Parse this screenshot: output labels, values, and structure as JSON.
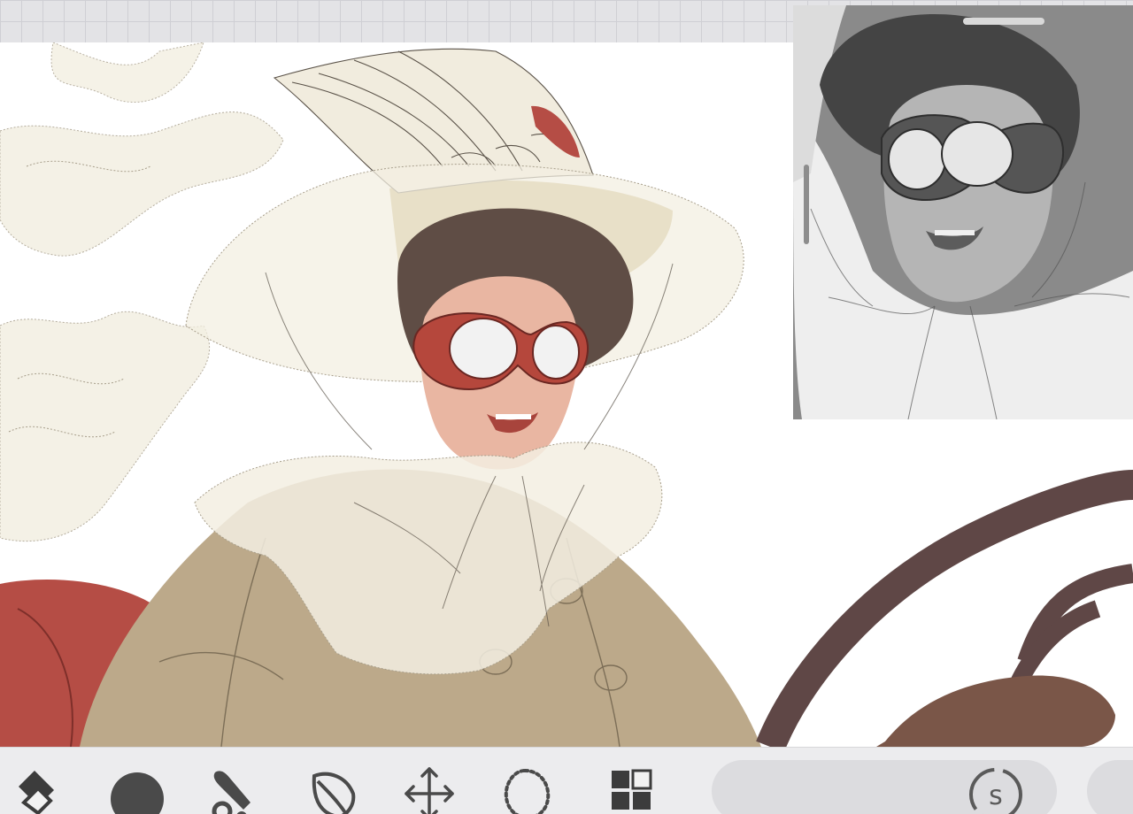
{
  "app": {
    "accent": "#4a4a4a",
    "canvas_background": "#ffffff"
  },
  "canvas": {
    "subject": "vintage-motorist-illustration",
    "palette": {
      "veil": "#f3efe2",
      "coat": "#bca98a",
      "hat_brim": "#c8b27c",
      "hair": "#5f4d45",
      "skin": "#e9b6a2",
      "goggles": "#b5473c",
      "seat": "#b54d45",
      "wheel": "#5f4746",
      "glove": "#7a5648"
    }
  },
  "reference_panel": {
    "mode": "grayscale"
  },
  "toolbar": {
    "tools": [
      {
        "id": "fill",
        "icon": "paint-bucket-icon"
      },
      {
        "id": "brush-size",
        "icon": "filled-circle-icon"
      },
      {
        "id": "brush",
        "icon": "brush-icon"
      },
      {
        "id": "smudge",
        "icon": "leaf-icon"
      },
      {
        "id": "move",
        "icon": "move-arrows-icon"
      },
      {
        "id": "lasso",
        "icon": "lasso-icon"
      },
      {
        "id": "layers",
        "icon": "layers-grid-icon"
      }
    ],
    "slider_icon": "s-circle-icon"
  }
}
